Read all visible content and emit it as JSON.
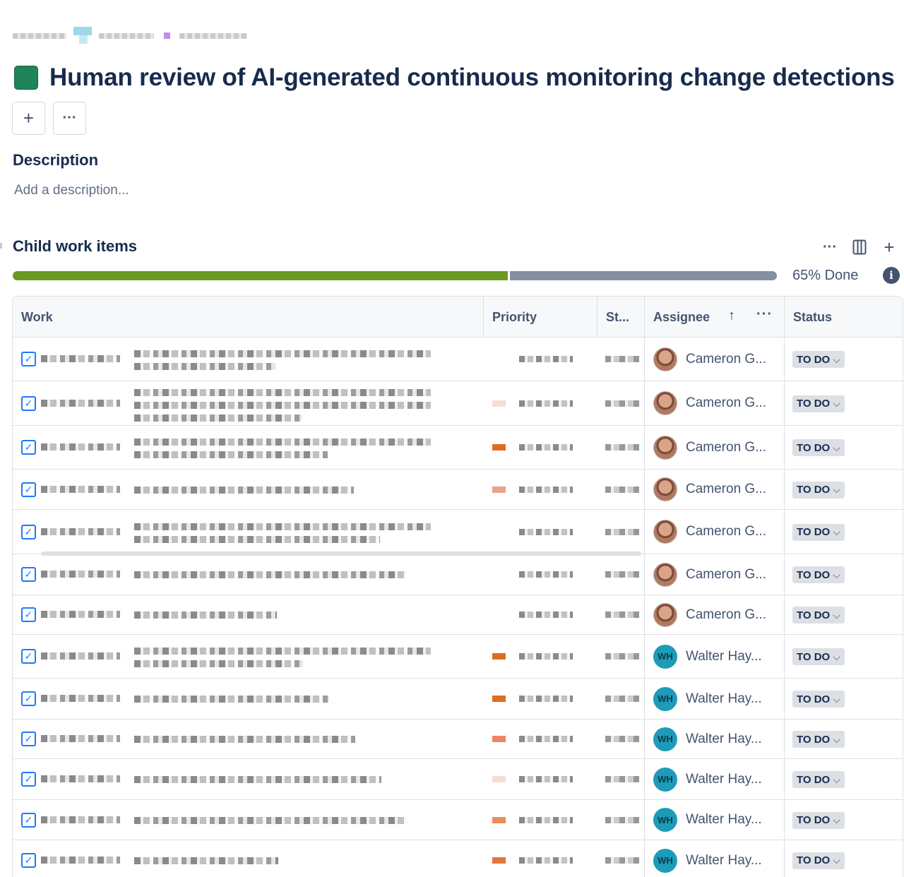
{
  "page": {
    "title": "Human review of AI-generated continuous monitoring change detections",
    "actions": {
      "add_label": "+",
      "more_label": "···"
    }
  },
  "description": {
    "heading": "Description",
    "placeholder": "Add a description..."
  },
  "child_items": {
    "heading": "Child work items",
    "progress": {
      "done_fraction": 0.65,
      "label": "65% Done"
    },
    "toolbar": {
      "more_label": "···",
      "add_label": "+"
    },
    "columns": [
      "Work",
      "Priority",
      "St...",
      "Assignee",
      "Status"
    ],
    "rows": [
      {
        "assignee": "Cameron G...",
        "avatar": "photo",
        "status": "TO DO",
        "priority_color": "",
        "lines": 2
      },
      {
        "assignee": "Cameron G...",
        "avatar": "photo",
        "status": "TO DO",
        "priority_color": "#f6ddd3",
        "lines": 3
      },
      {
        "assignee": "Cameron G...",
        "avatar": "photo",
        "status": "TO DO",
        "priority_color": "#e06c1e",
        "lines": 2
      },
      {
        "assignee": "Cameron G...",
        "avatar": "photo",
        "status": "TO DO",
        "priority_color": "#e9a28b",
        "lines": 1
      },
      {
        "assignee": "Cameron G...",
        "avatar": "photo",
        "status": "TO DO",
        "priority_color": "",
        "lines": 2
      },
      {
        "assignee": "Cameron G...",
        "avatar": "photo",
        "status": "TO DO",
        "priority_color": "",
        "lines": 1
      },
      {
        "assignee": "Cameron G...",
        "avatar": "photo",
        "status": "TO DO",
        "priority_color": "",
        "lines": 1
      },
      {
        "assignee": "Walter Hay...",
        "avatar": "WH",
        "status": "TO DO",
        "priority_color": "#e06c1e",
        "lines": 2
      },
      {
        "assignee": "Walter Hay...",
        "avatar": "WH",
        "status": "TO DO",
        "priority_color": "#e06c1e",
        "lines": 1
      },
      {
        "assignee": "Walter Hay...",
        "avatar": "WH",
        "status": "TO DO",
        "priority_color": "#ea8664",
        "lines": 1
      },
      {
        "assignee": "Walter Hay...",
        "avatar": "WH",
        "status": "TO DO",
        "priority_color": "#f6ddd3",
        "lines": 1
      },
      {
        "assignee": "Walter Hay...",
        "avatar": "WH",
        "status": "TO DO",
        "priority_color": "#ea8f5a",
        "lines": 1
      },
      {
        "assignee": "Walter Hay...",
        "avatar": "WH",
        "status": "TO DO",
        "priority_color": "#e2753a",
        "lines": 1
      }
    ]
  },
  "colors": {
    "epic": "#1f845a",
    "progress_done": "#6a9a23",
    "progress_rest": "#8590a2",
    "task_icon": "#1d7afc"
  },
  "icons": [
    "epic-icon",
    "plus-icon",
    "more-icon",
    "columns-icon",
    "info-icon",
    "task-icon",
    "sort-up-icon",
    "chevron-down-icon"
  ]
}
